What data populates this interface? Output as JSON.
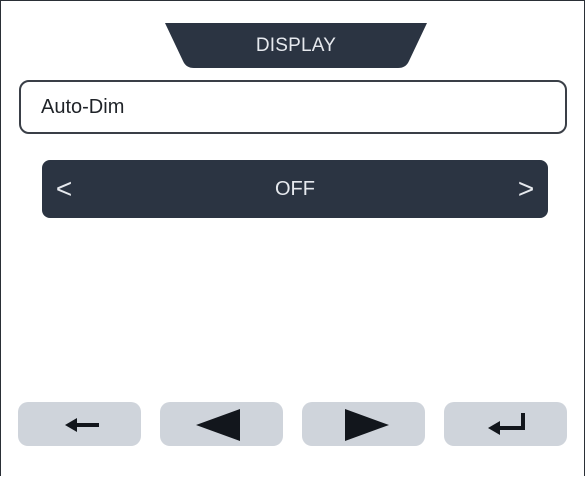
{
  "header": {
    "title": "DISPLAY"
  },
  "setting": {
    "name": "Auto-Dim"
  },
  "selector": {
    "prev_label": "<",
    "value": "OFF",
    "next_label": ">"
  },
  "buttons": [
    {
      "name": "back-button",
      "icon": "arrow-left-icon"
    },
    {
      "name": "prev-button",
      "icon": "triangle-left-icon"
    },
    {
      "name": "next-button",
      "icon": "triangle-right-icon"
    },
    {
      "name": "enter-button",
      "icon": "enter-return-icon"
    }
  ],
  "colors": {
    "dark": "#2b3442",
    "button_bg": "#cfd4db",
    "light_text": "#e6e9ee",
    "icon": "#12161c"
  }
}
